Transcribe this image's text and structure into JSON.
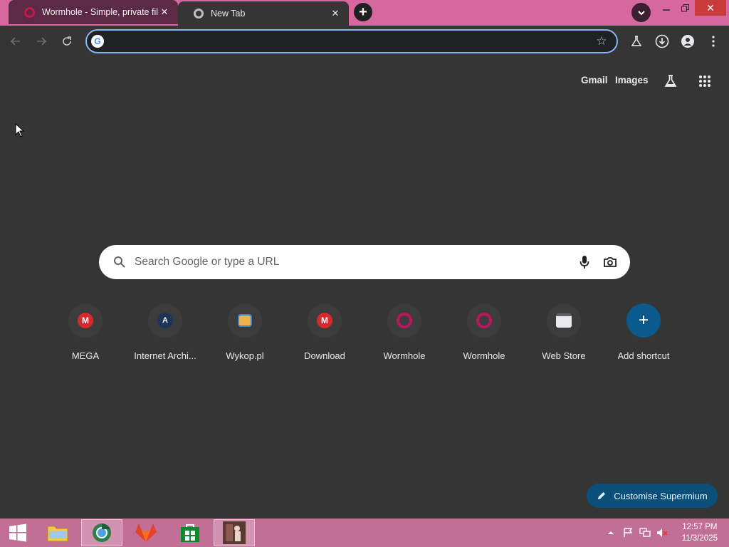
{
  "tabs": [
    {
      "title": "Wormhole - Simple, private file",
      "favicon": "wormhole-favicon",
      "state": "inactive"
    },
    {
      "title": "New Tab",
      "favicon": "chrome-favicon",
      "state": "active"
    }
  ],
  "omnibox": {
    "value": "",
    "placeholder": ""
  },
  "ntp_header": {
    "gmail": "Gmail",
    "images": "Images"
  },
  "search": {
    "placeholder": "Search Google or type a URL"
  },
  "shortcuts": [
    {
      "label": "MEGA",
      "icon": "mega-icon",
      "glyph": "M"
    },
    {
      "label": "Internet Archi...",
      "icon": "internet-archive-icon",
      "glyph": "A"
    },
    {
      "label": "Wykop.pl",
      "icon": "wykop-icon"
    },
    {
      "label": "Download",
      "icon": "mega-icon",
      "glyph": "M"
    },
    {
      "label": "Wormhole",
      "icon": "wormhole-icon"
    },
    {
      "label": "Wormhole",
      "icon": "wormhole-icon"
    },
    {
      "label": "Web Store",
      "icon": "web-store-icon"
    },
    {
      "label": "Add shortcut",
      "icon": "plus-icon",
      "glyph": "+"
    }
  ],
  "customise": {
    "label": "Customise Supermium"
  },
  "taskbar": {
    "items": [
      "start-button",
      "file-explorer",
      "supermium-browser",
      "gitlab-app",
      "store-app",
      "photo-app"
    ],
    "clock_time": "12:57 PM",
    "clock_date": "11/3/2025"
  },
  "colors": {
    "tabstrip": "#d6689f",
    "page_background": "#353535",
    "taskbar": "#c26f95",
    "accent": "#8ab4f8"
  }
}
